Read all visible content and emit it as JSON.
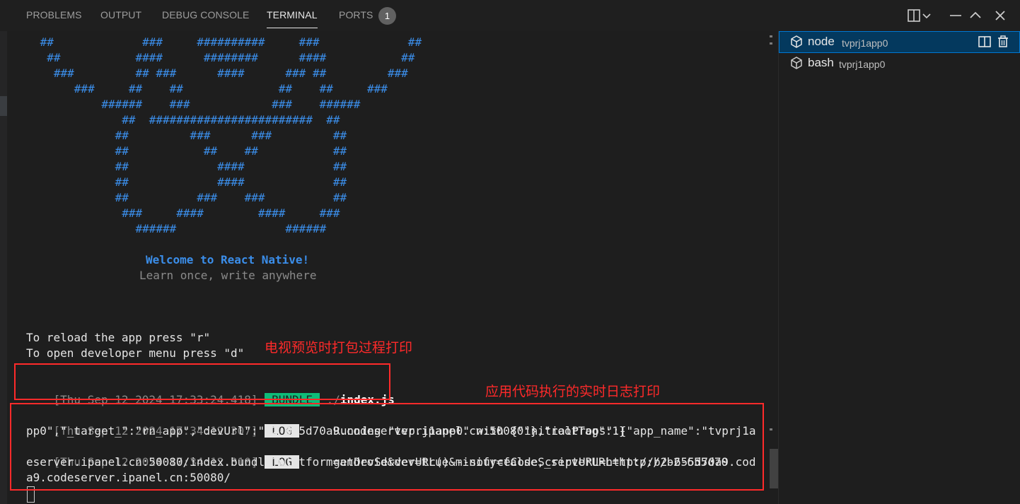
{
  "panel_tabs": [
    {
      "label": "PROBLEMS"
    },
    {
      "label": "OUTPUT"
    },
    {
      "label": "DEBUG CONSOLE"
    },
    {
      "label": "TERMINAL"
    },
    {
      "label": "PORTS"
    }
  ],
  "ports_badge": "1",
  "ascii_art": [
    " ##             ###     ##########     ###             ##",
    "  ##           ####      ########      ####           ##",
    "   ###         ## ###      ####      ### ##         ###",
    "      ###     ##    ##              ##    ##     ###",
    "          ######    ###            ###    ######",
    "             ##  ########################  ##",
    "            ##         ###      ###         ##",
    "            ##           ##    ##           ##",
    "            ##             ####             ##",
    "            ##             ####             ##",
    "            ##          ###    ###          ##",
    "             ###     ####        ####     ###",
    "               ######                ######"
  ],
  "welcome": "Welcome to React Native!",
  "tagline": "Learn once, write anywhere",
  "reload_hint": "To reload the app press \"r\"",
  "devmenu_hint": "To open developer menu press \"d\"",
  "bundle_line": {
    "timestamp": "[Thu Sep 12 2024 17:33:24.418]",
    "tag": "BUNDLE",
    "path_prefix": "./",
    "path_file": "index.js"
  },
  "log_lines": [
    {
      "timestamp": "[Thu Sep 12 2024 17:34:12.307]",
      "tag": "LOG",
      "msg1": "     Running \"tvprj1app0\" with {\"initialProps\":{\"app_name\":\"tvprj1a",
      "msg2": "pp0\",\"_target_\":\"rn_app\",\"devUrl\":\"b2-655d70a9.codeserver.ipanel.cn:50080\"},\"rootTag\":1}"
    },
    {
      "timestamp": "[Thu Sep 12 2024 17:34:12.310]",
      "tag": "LOG",
      "msg1": "     getDevServerURL()---sourceCodeScriptURL=http://b2-655d70a9.cod",
      "msg2": "eserver.ipanel.cn:50080/index.bundle?platform=android&dev=true&minify=false,_serverURL=http://b2-655d70",
      "msg3": "a9.codeserver.ipanel.cn:50080/"
    }
  ],
  "annotations": {
    "bundle": "电视预览时打包过程打印",
    "log": "应用代码执行的实时日志打印"
  },
  "terminals": [
    {
      "name": "node",
      "sub": "tvprj1app0",
      "selected": true
    },
    {
      "name": "bash",
      "sub": "tvprj1app0",
      "selected": false
    }
  ],
  "icons": [
    "split-terminal-icon",
    "trash-icon",
    "layout-icon",
    "chevron-down-icon",
    "chevron-up-icon",
    "close-icon",
    "terminal-cube-icon"
  ]
}
